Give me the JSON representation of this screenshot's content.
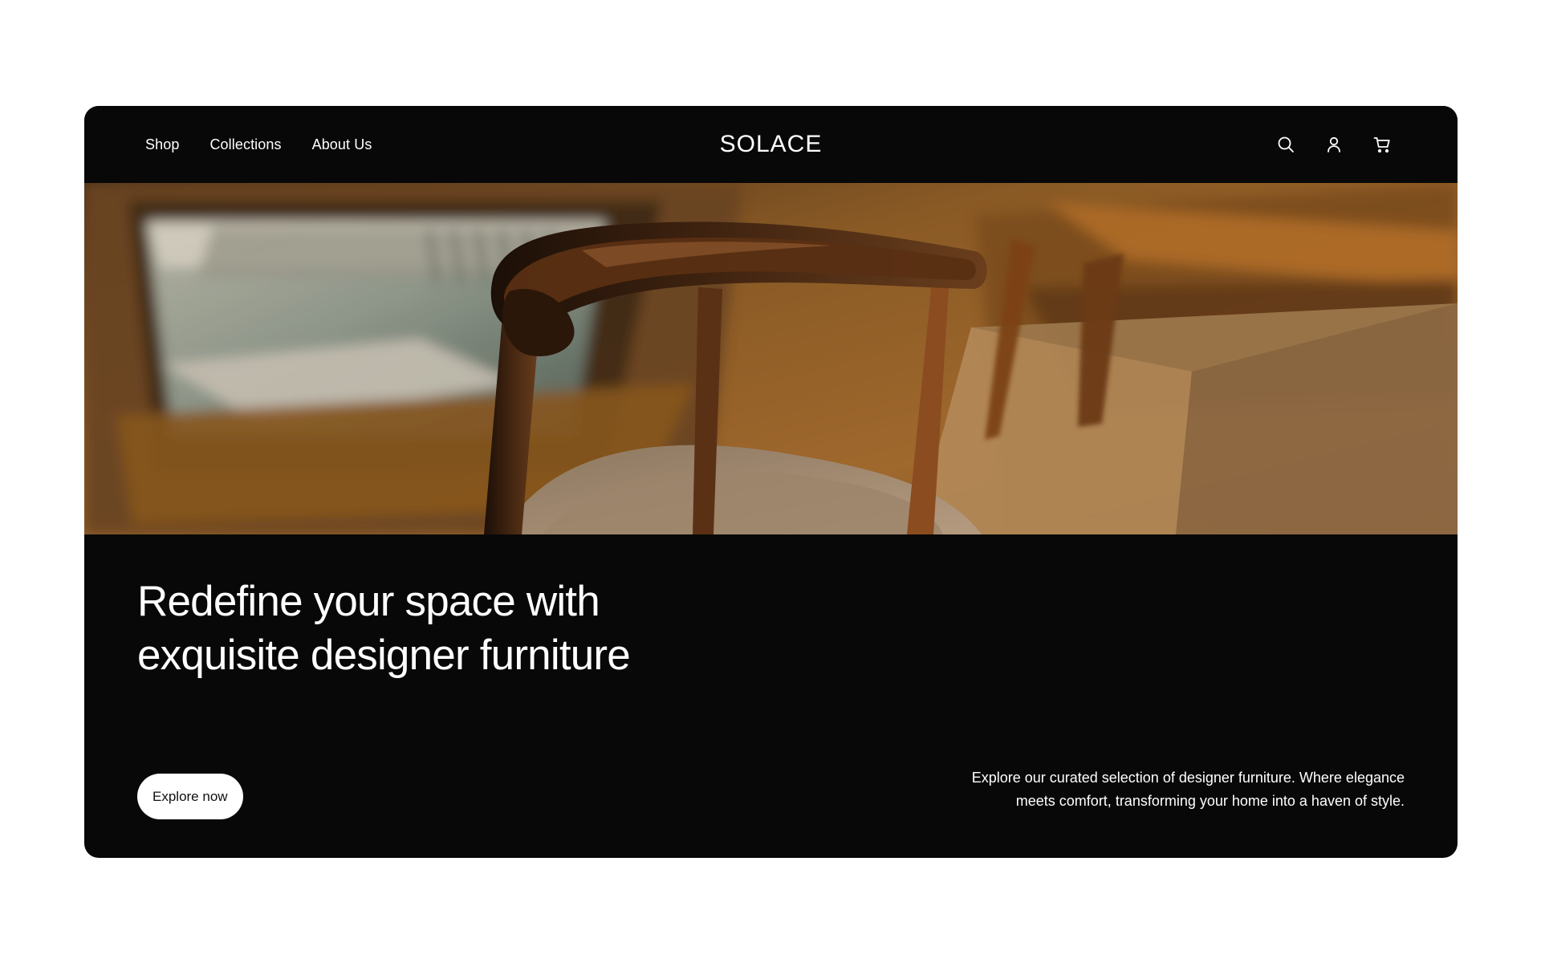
{
  "nav": {
    "links": [
      {
        "label": "Shop"
      },
      {
        "label": "Collections"
      },
      {
        "label": "About Us"
      }
    ],
    "logo": "SOLACE",
    "icons": [
      "search-icon",
      "user-icon",
      "cart-icon"
    ]
  },
  "hero": {
    "title": "Redefine your space with exquisite designer furniture",
    "button_label": "Explore now",
    "description": "Explore our curated selection of designer furniture. Where elegance meets comfort, transforming your home into a haven of style."
  },
  "colors": {
    "background": "#ffffff",
    "frame": "#080808",
    "text": "#ffffff",
    "button_background": "#ffffff",
    "button_text": "#111111"
  }
}
